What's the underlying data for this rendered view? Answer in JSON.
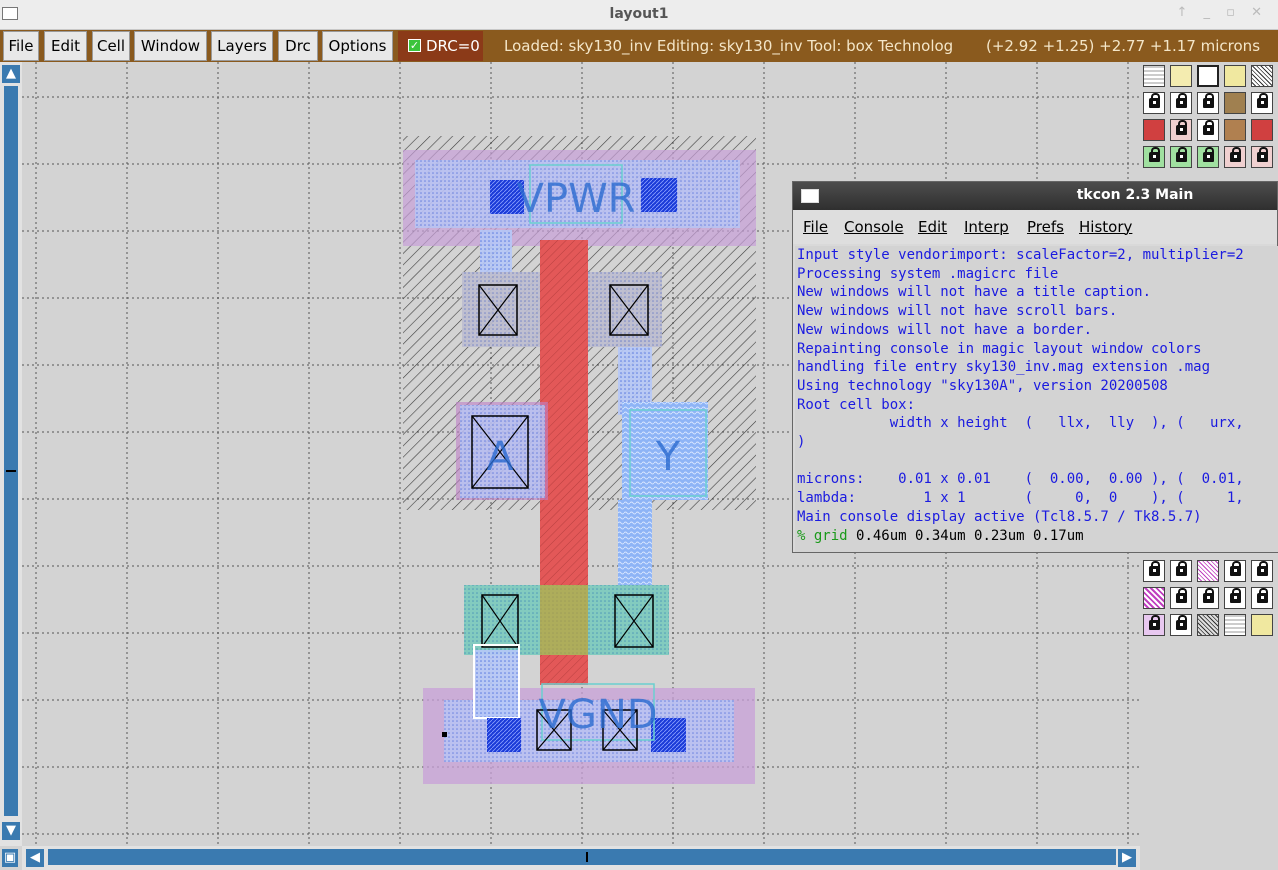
{
  "window": {
    "title": "layout1",
    "controls": "↑ _ ▫ ✕"
  },
  "menu": {
    "items": [
      "File",
      "Edit",
      "Cell",
      "Window",
      "Layers",
      "Drc",
      "Options"
    ],
    "drc_label": "DRC=0",
    "status_text": "Loaded: sky130_inv Editing: sky130_inv Tool: box  Technolog",
    "coords": "(+2.92 +1.25) +2.77 +1.17 microns"
  },
  "layout": {
    "labels": {
      "vpwr": "VPWR",
      "vgnd": "VGND",
      "input": "A",
      "output": "Y"
    }
  },
  "colors": {
    "menubar": "#8a5a1e",
    "drc": "#8b3a18",
    "poly": "#e05050",
    "metal1": "#8ab0f0",
    "diffusion": "#30d070",
    "nwell": "#b098e0"
  },
  "tkcon": {
    "title": "tkcon 2.3 Main",
    "menu": [
      "File",
      "Console",
      "Edit",
      "Interp",
      "Prefs",
      "History"
    ],
    "lines": [
      "Input style vendorimport: scaleFactor=2, multiplier=2",
      "Processing system .magicrc file",
      "New windows will not have a title caption.",
      "New windows will not have scroll bars.",
      "New windows will not have a border.",
      "Repainting console in magic layout window colors",
      "handling file entry sky130_inv.mag extension .mag",
      "Using technology \"sky130A\", version 20200508",
      "Root cell box:",
      "           width x height  (   llx,  lly  ), (   urx,",
      ")",
      "",
      "microns:    0.01 x 0.01    (  0.00,  0.00 ), (  0.01,",
      "lambda:        1 x 1       (     0,  0    ), (     1,",
      "Main console display active (Tcl8.5.7 / Tk8.5.7)"
    ],
    "prompt": "%",
    "command": "grid",
    "command_args": " 0.46um 0.34um 0.23um 0.17um"
  },
  "palette_icons": [
    "solid-layer",
    "outline-layer",
    "box-layer",
    "hatched-layer",
    "lock-icon"
  ]
}
